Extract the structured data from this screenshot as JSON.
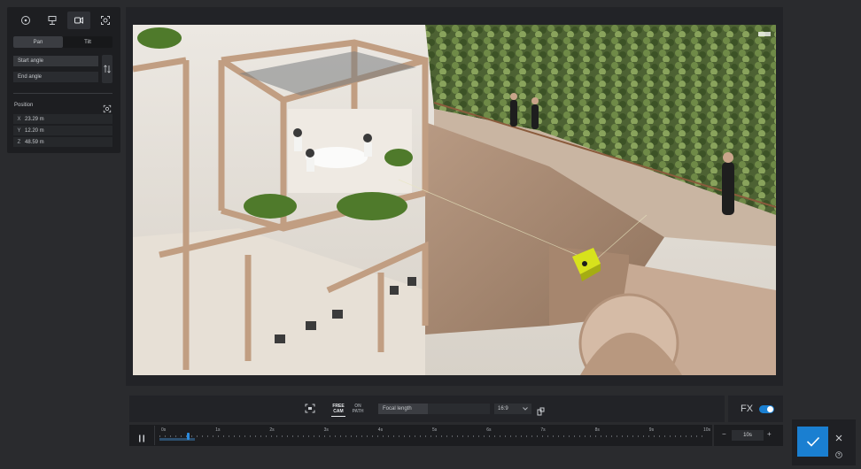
{
  "left_panel": {
    "mode_buttons": [
      {
        "icon": "orbit-icon"
      },
      {
        "icon": "tripod-icon"
      },
      {
        "icon": "camera-path-icon"
      },
      {
        "icon": "focus-target-icon"
      }
    ],
    "tabs": {
      "pan": "Pan",
      "tilt": "Tilt"
    },
    "start_angle": "Start angle",
    "end_angle": "End angle",
    "position_label": "Position",
    "x_label": "X",
    "x_value": "23.29 m",
    "y_label": "Y",
    "y_value": "12.20 m",
    "z_label": "Z",
    "z_value": "48.59 m"
  },
  "toolbar": {
    "free_cam": "FREE CAM",
    "on_path": "ON PATH",
    "focal_length_label": "Focal length",
    "aspect_ratio": "16:9"
  },
  "fx": {
    "label": "FX",
    "enabled": true
  },
  "timeline": {
    "ticks": [
      "0s",
      "1s",
      "2s",
      "3s",
      "4s",
      "5s",
      "6s",
      "7s",
      "8s",
      "9s",
      "10s"
    ],
    "playhead_fraction": 0.05
  },
  "duration": {
    "minus": "−",
    "value": "10s",
    "plus": "+"
  },
  "colors": {
    "accent": "#1a7fd1",
    "panel": "#1d1e21",
    "background": "#2a2b2e"
  }
}
